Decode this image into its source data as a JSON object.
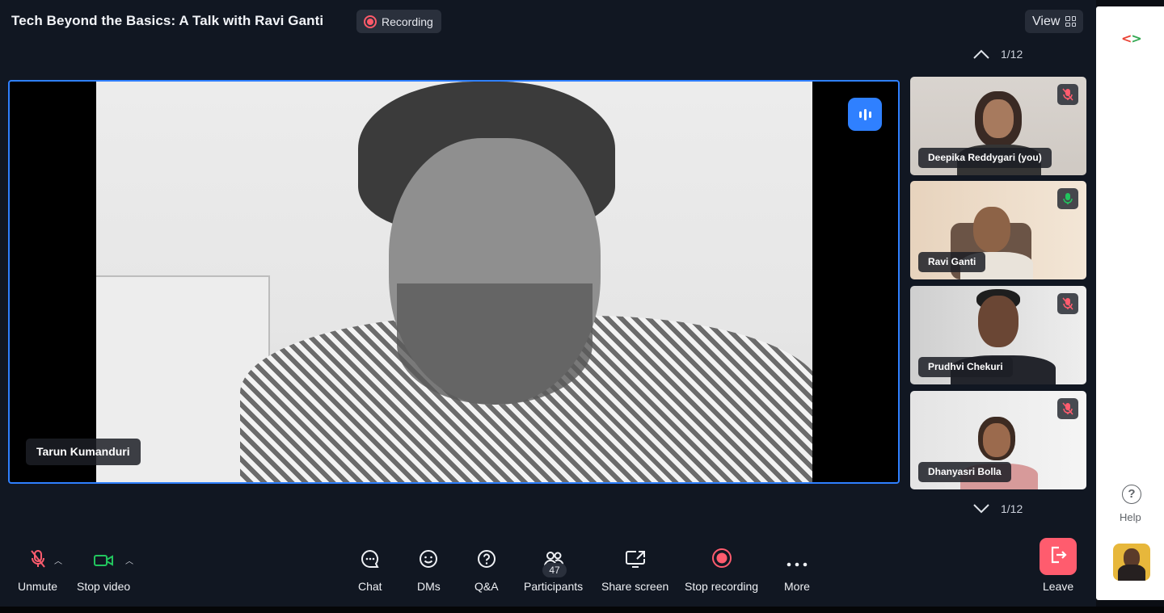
{
  "meeting": {
    "title": "Tech Beyond the Basics: A Talk with Ravi Ganti",
    "recording_label": "Recording"
  },
  "view_button": {
    "label": "View",
    "icon": "grid-icon"
  },
  "pager": {
    "top_label": "1/12",
    "bottom_label": "1/12"
  },
  "main_video": {
    "speaker_name": "Tarun Kumanduri",
    "speaking_icon": "audio-wave-icon"
  },
  "participants_thumbs": [
    {
      "name": "Deepika Reddygari (you)",
      "mic": "muted"
    },
    {
      "name": "Ravi Ganti",
      "mic": "active"
    },
    {
      "name": "Prudhvi Chekuri",
      "mic": "muted"
    },
    {
      "name": "Dhanyasri Bolla",
      "mic": "muted"
    }
  ],
  "toolbar": {
    "unmute": "Unmute",
    "stop_video": "Stop video",
    "chat": "Chat",
    "dms": "DMs",
    "qa": "Q&A",
    "participants": "Participants",
    "participant_count": "47",
    "share_screen": "Share screen",
    "stop_recording": "Stop recording",
    "more": "More",
    "leave": "Leave"
  },
  "side_panel": {
    "help_label": "Help",
    "help_icon": "?"
  },
  "colors": {
    "accent": "#2f80ff",
    "danger": "#ff5c6e",
    "mic_active": "#22c55e",
    "background": "#111722"
  }
}
